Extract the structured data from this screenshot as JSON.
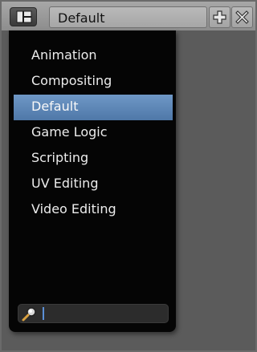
{
  "header": {
    "editor_type_icon": "screen-layout-icon",
    "layout_name": "Default",
    "add_icon": "plus-icon",
    "delete_icon": "x-icon"
  },
  "menu": {
    "items": [
      {
        "label": "Animation",
        "selected": false
      },
      {
        "label": "Compositing",
        "selected": false
      },
      {
        "label": "Default",
        "selected": true
      },
      {
        "label": "Game Logic",
        "selected": false
      },
      {
        "label": "Scripting",
        "selected": false
      },
      {
        "label": "UV Editing",
        "selected": false
      },
      {
        "label": "Video Editing",
        "selected": false
      }
    ],
    "selected_color": "#5f88b8"
  },
  "search": {
    "icon": "magnifier-icon",
    "value": "",
    "placeholder": ""
  }
}
